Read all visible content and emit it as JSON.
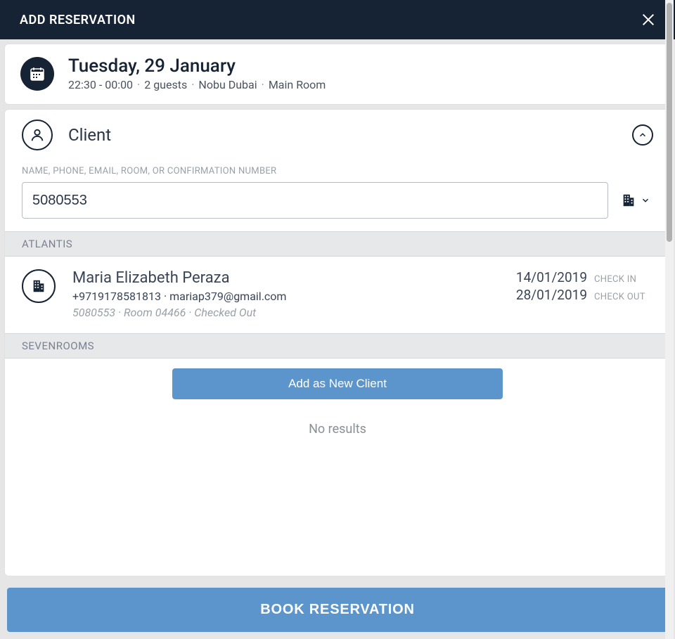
{
  "header": {
    "title": "ADD RESERVATION"
  },
  "summary": {
    "date": "Tuesday, 29 January",
    "time": "22:30 - 00:00",
    "guests": "2 guests",
    "venue": "Nobu Dubai",
    "room": "Main Room"
  },
  "client": {
    "section_title": "Client",
    "search_label": "NAME, PHONE, EMAIL, ROOM, OR CONFIRMATION NUMBER",
    "search_value": "5080553"
  },
  "groups": [
    {
      "name": "ATLANTIS",
      "results": [
        {
          "name": "Maria Elizabeth Peraza",
          "phone": "+9719178581813",
          "email": "mariap379@gmail.com",
          "confirmation": "5080553",
          "room": "Room 04466",
          "status": "Checked Out",
          "check_in": "14/01/2019",
          "check_out": "28/01/2019",
          "check_in_label": "CHECK IN",
          "check_out_label": "CHECK OUT"
        }
      ]
    },
    {
      "name": "SEVENROOMS",
      "add_new_label": "Add as New Client",
      "no_results_label": "No results"
    }
  ],
  "footer": {
    "book_label": "BOOK RESERVATION"
  }
}
